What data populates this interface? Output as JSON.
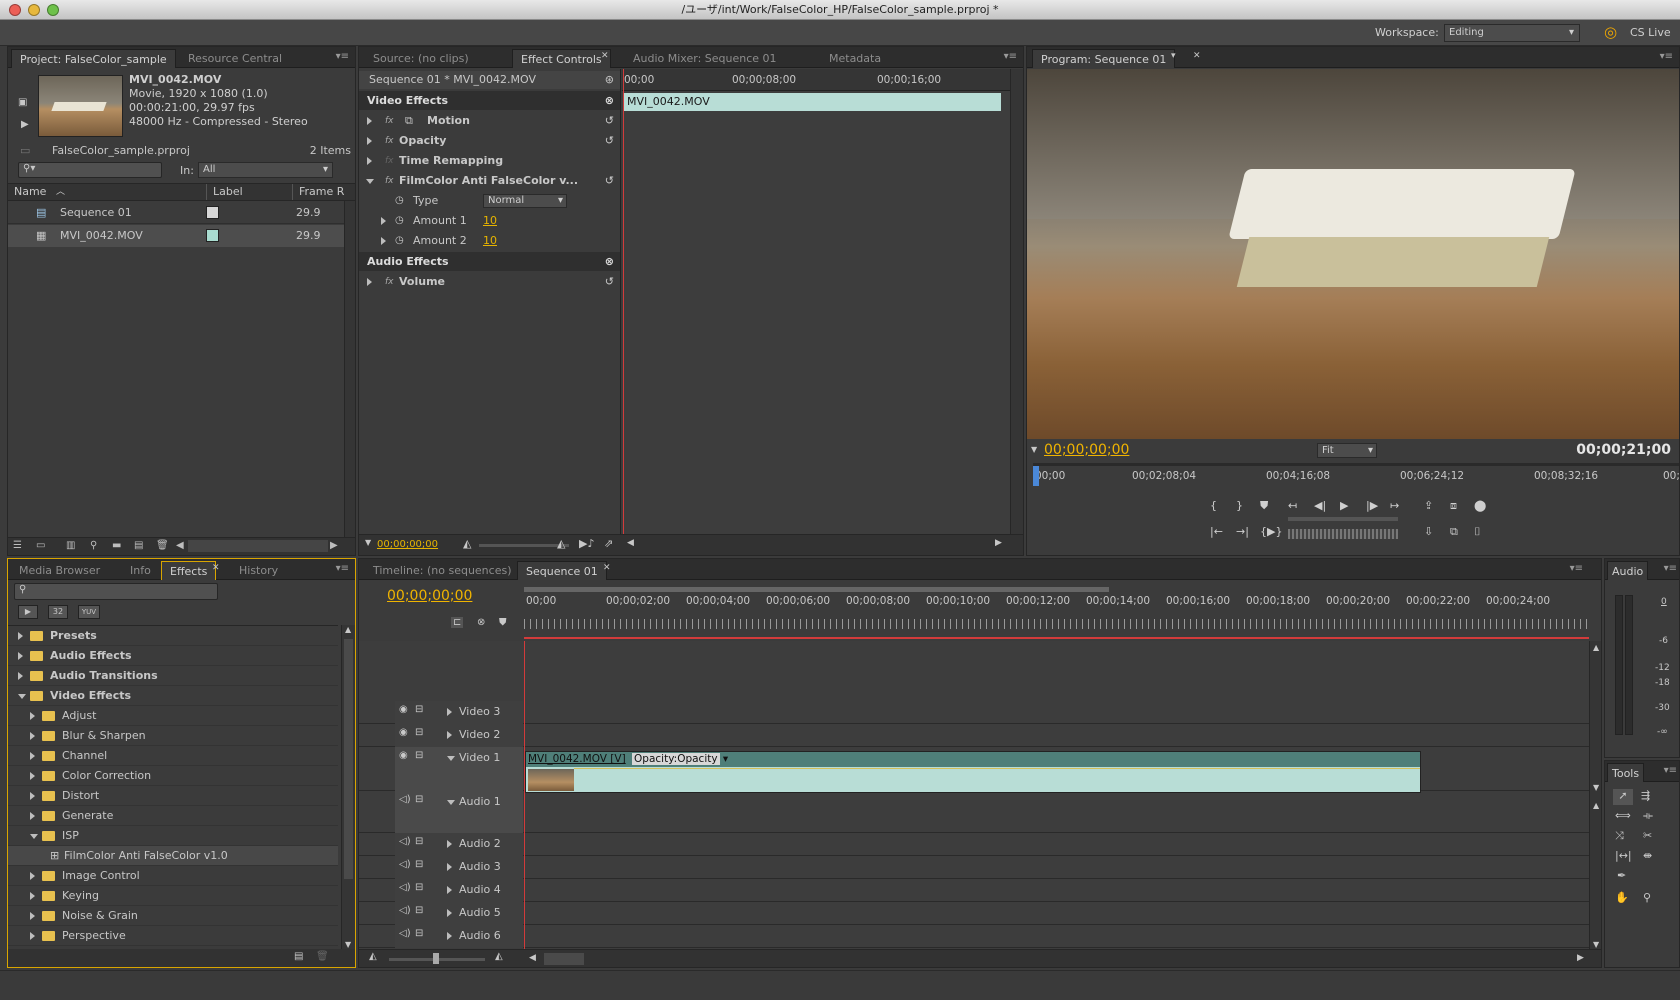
{
  "window": {
    "title": "/ユーザ/int/Work/FalseColor_HP/FalseColor_sample.prproj *"
  },
  "workspace": {
    "label": "Workspace:",
    "value": "Editing",
    "cs_live": "CS Live"
  },
  "project": {
    "tabs": [
      "Project: FalseColor_sample",
      "Resource Central"
    ],
    "clip": {
      "name": "MVI_0042.MOV",
      "line1": "Movie, 1920 x 1080 (1.0)",
      "line2": "00:00:21:00, 29.97 fps",
      "line3": "48000 Hz - Compressed - Stereo"
    },
    "file": "FalseColor_sample.prproj",
    "items": "2 Items",
    "in_label": "In:",
    "in_value": "All",
    "columns": [
      "Name",
      "Label",
      "Frame R"
    ],
    "rows": [
      {
        "name": "Sequence 01",
        "fps": "29.9",
        "color": "#d7d7d7"
      },
      {
        "name": "MVI_0042.MOV",
        "fps": "29.9",
        "color": "#a9dcd0"
      }
    ]
  },
  "source": {
    "tabs": [
      "Source: (no clips)",
      "Effect Controls",
      "Audio Mixer: Sequence 01",
      "Metadata"
    ],
    "header": "Sequence 01 * MVI_0042.MOV",
    "ruler": [
      "00;00",
      "00;00;08;00",
      "00;00;16;00"
    ],
    "clip_label": "MVI_0042.MOV",
    "video_effects": "Video Effects",
    "audio_effects": "Audio Effects",
    "motion": "Motion",
    "opacity": "Opacity",
    "time_remap": "Time Remapping",
    "filmcolor": "FilmColor Anti FalseColor v...",
    "type_label": "Type",
    "type_value": "Normal",
    "amount1_label": "Amount 1",
    "amount1_value": "10",
    "amount2_label": "Amount 2",
    "amount2_value": "10",
    "volume": "Volume",
    "timecode": "00;00;00;00",
    "fx": "fx"
  },
  "program": {
    "tab": "Program: Sequence 01",
    "timecode": "00;00;00;00",
    "fit": "Fit",
    "duration": "00;00;21;00",
    "ruler": [
      "00;00",
      "00;02;08;04",
      "00;04;16;08",
      "00;06;24;12",
      "00;08;32;16",
      "00;"
    ]
  },
  "effects": {
    "tabs": [
      "Media Browser",
      "Info",
      "Effects",
      "History"
    ],
    "badges": [
      "32",
      "YUV"
    ],
    "tree": [
      {
        "label": "Presets",
        "level": 0,
        "open": false,
        "bold": true
      },
      {
        "label": "Audio Effects",
        "level": 0,
        "open": false,
        "bold": true
      },
      {
        "label": "Audio Transitions",
        "level": 0,
        "open": false,
        "bold": true
      },
      {
        "label": "Video Effects",
        "level": 0,
        "open": true,
        "bold": true
      },
      {
        "label": "Adjust",
        "level": 1,
        "open": false
      },
      {
        "label": "Blur & Sharpen",
        "level": 1,
        "open": false
      },
      {
        "label": "Channel",
        "level": 1,
        "open": false
      },
      {
        "label": "Color Correction",
        "level": 1,
        "open": false
      },
      {
        "label": "Distort",
        "level": 1,
        "open": false
      },
      {
        "label": "Generate",
        "level": 1,
        "open": false
      },
      {
        "label": "ISP",
        "level": 1,
        "open": true
      },
      {
        "label": "FilmColor Anti FalseColor v1.0",
        "level": 2,
        "effect": true
      },
      {
        "label": "Image Control",
        "level": 1,
        "open": false
      },
      {
        "label": "Keying",
        "level": 1,
        "open": false
      },
      {
        "label": "Noise & Grain",
        "level": 1,
        "open": false
      },
      {
        "label": "Perspective",
        "level": 1,
        "open": false
      }
    ]
  },
  "timeline": {
    "tabs": [
      "Timeline: (no sequences)",
      "Sequence 01"
    ],
    "timecode": "00;00;00;00",
    "ruler": [
      "00;00",
      "00;00;02;00",
      "00;00;04;00",
      "00;00;06;00",
      "00;00;08;00",
      "00;00;10;00",
      "00;00;12;00",
      "00;00;14;00",
      "00;00;16;00",
      "00;00;18;00",
      "00;00;20;00",
      "00;00;22;00",
      "00;00;24;00"
    ],
    "video_tracks": [
      "Video 3",
      "Video 2",
      "Video 1"
    ],
    "audio_tracks": [
      "Audio 1",
      "Audio 2",
      "Audio 3",
      "Audio 4",
      "Audio 5",
      "Audio 6"
    ],
    "clip_name": "MVI_0042.MOV [V]",
    "clip_fx": "Opacity:Opacity"
  },
  "audio_meter": {
    "tab": "Audio",
    "scale": [
      "0",
      "-6",
      "-12",
      "-18",
      "-30",
      "-∞"
    ]
  },
  "tools": {
    "tab": "Tools"
  }
}
